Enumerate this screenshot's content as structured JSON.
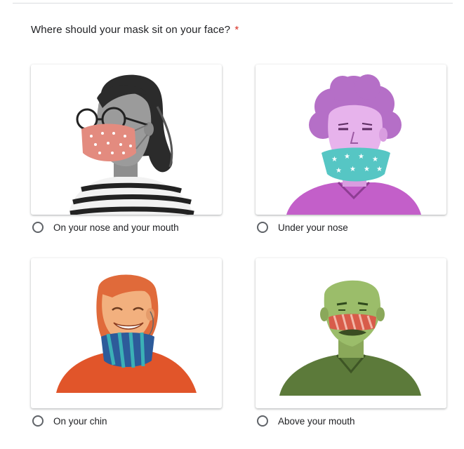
{
  "question": {
    "text": "Where should your mask sit on your face?",
    "required_marker": "*"
  },
  "options": [
    {
      "label": "On your nose and your mouth",
      "image": "woman-with-glasses-mask-over-nose-and-mouth"
    },
    {
      "label": "Under your nose",
      "image": "person-purple-hair-mask-under-nose"
    },
    {
      "label": "On your chin",
      "image": "woman-orange-hair-mask-on-chin"
    },
    {
      "label": "Above your mouth",
      "image": "man-green-mask-above-mouth"
    }
  ],
  "colors": {
    "required": "#d93025",
    "radio_border": "#5f6368",
    "text": "#202124"
  }
}
